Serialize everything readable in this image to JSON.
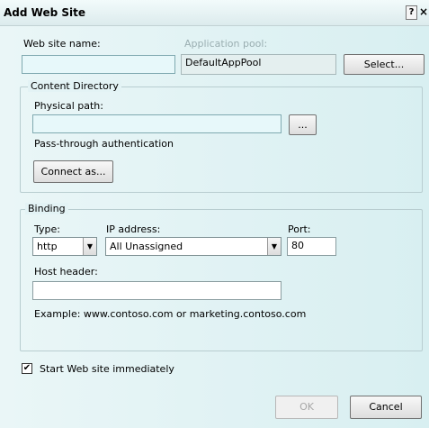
{
  "window": {
    "title": "Add Web Site",
    "help_label": "?",
    "close_label": "×"
  },
  "site": {
    "name_label": "Web site name:",
    "name_value": "",
    "app_pool_label": "Application pool:",
    "app_pool_value": "DefaultAppPool",
    "select_button": "Select..."
  },
  "content_directory": {
    "legend": "Content Directory",
    "physical_path_label": "Physical path:",
    "physical_path_value": "",
    "browse_button": "...",
    "pass_through_label": "Pass-through authentication",
    "connect_as_button": "Connect as..."
  },
  "binding": {
    "legend": "Binding",
    "type_label": "Type:",
    "type_value": "http",
    "ip_label": "IP address:",
    "ip_value": "All Unassigned",
    "port_label": "Port:",
    "port_value": "80",
    "host_header_label": "Host header:",
    "host_header_value": "",
    "example_text": "Example: www.contoso.com or marketing.contoso.com"
  },
  "start_immediately": {
    "label": "Start Web site immediately",
    "checked": true,
    "check_glyph": "✔"
  },
  "footer": {
    "ok_button": "OK",
    "cancel_button": "Cancel"
  }
}
